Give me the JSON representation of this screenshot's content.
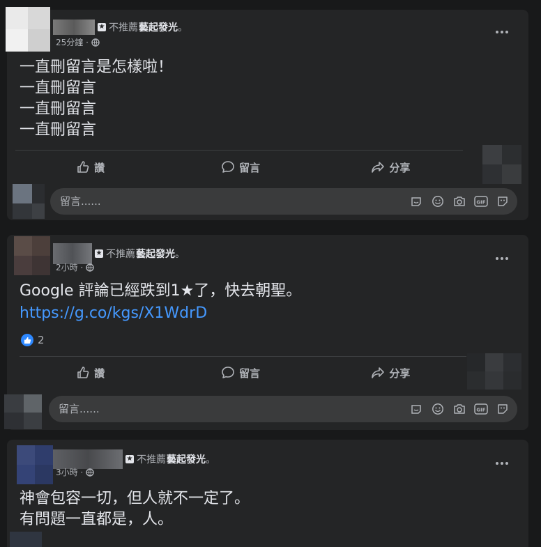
{
  "posts": [
    {
      "author_tag": "不推薦",
      "page_name": "藝起發光",
      "period": "。",
      "time": "25分鐘",
      "text": "一直刪留言是怎樣啦！\n一直刪留言\n一直刪留言\n一直刪留言",
      "actions": {
        "like": "讚",
        "comment": "留言",
        "share": "分享"
      },
      "comment_placeholder": "留言......"
    },
    {
      "author_tag": "不推薦",
      "page_name": "藝起發光",
      "period": "。",
      "time": "2小時",
      "text": "Google 評論已經跌到1★了，快去朝聖。",
      "link": "https://g.co/kgs/X1WdrD",
      "reaction_count": "2",
      "actions": {
        "like": "讚",
        "comment": "留言",
        "share": "分享"
      },
      "comment_placeholder": "留言......"
    },
    {
      "author_tag": "不推薦",
      "page_name": "藝起發光",
      "period": "。",
      "time": "3小時",
      "text": "神會包容一切，但人就不一定了。\n有問題一直都是，人。"
    }
  ],
  "colors": {
    "background": "#18191a",
    "card": "#242526",
    "link": "#4599ff",
    "like_blue": "#2d88ff"
  },
  "icons": [
    "more-icon",
    "globe-icon",
    "like-icon",
    "comment-icon",
    "share-icon",
    "sticker-icon",
    "emoji-icon",
    "camera-icon",
    "gif-icon",
    "avatar-sticker-icon"
  ]
}
